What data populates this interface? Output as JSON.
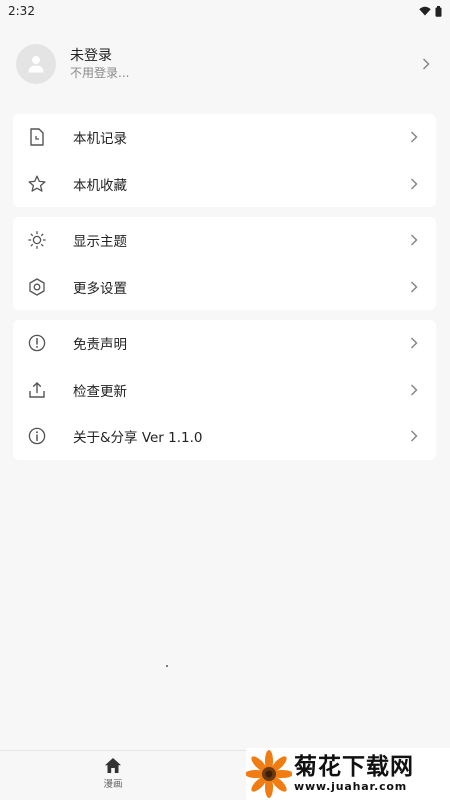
{
  "status_bar": {
    "time": "2:32"
  },
  "profile": {
    "name": "未登录",
    "subtitle": "不用登录..."
  },
  "menu_groups": [
    {
      "items": [
        {
          "label": "本机记录",
          "icon": "history-icon"
        },
        {
          "label": "本机收藏",
          "icon": "star-icon"
        }
      ]
    },
    {
      "items": [
        {
          "label": "显示主题",
          "icon": "theme-icon"
        },
        {
          "label": "更多设置",
          "icon": "settings-icon"
        }
      ]
    },
    {
      "items": [
        {
          "label": "免责声明",
          "icon": "alert-icon"
        },
        {
          "label": "检查更新",
          "icon": "upload-icon"
        },
        {
          "label": "关于&分享 Ver 1.1.0",
          "icon": "info-icon"
        }
      ]
    }
  ],
  "bottom_nav": {
    "items": [
      {
        "label": "漫画",
        "icon": "home-icon"
      }
    ]
  },
  "watermark": {
    "title": "菊花下载网",
    "url": "www.juahar.com"
  },
  "colors": {
    "background": "#f7f7f7",
    "card": "#ffffff",
    "text": "#222222",
    "muted": "#8a8a8a",
    "icon": "#555555"
  }
}
